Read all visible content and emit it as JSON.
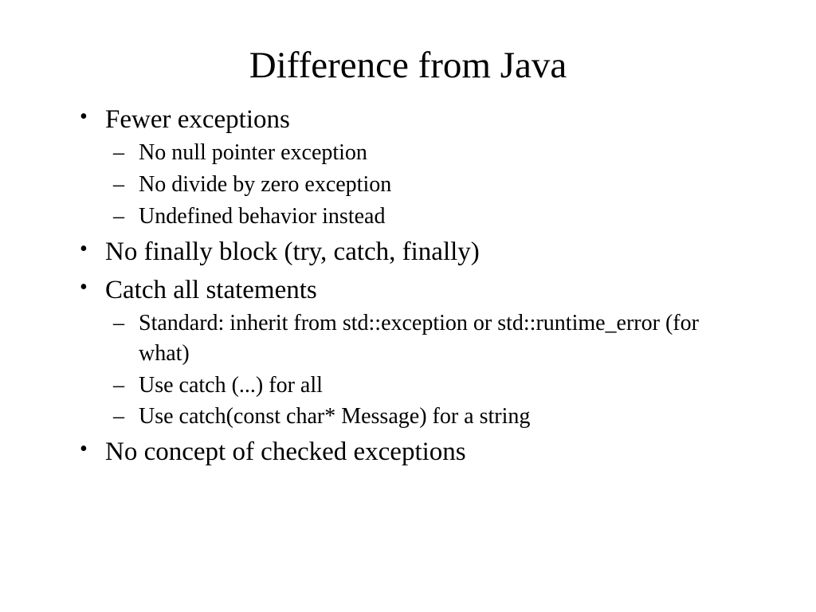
{
  "title": "Difference from Java",
  "bullets": {
    "b1": "Fewer exceptions",
    "b1_1": "No null pointer exception",
    "b1_2": "No divide by zero exception",
    "b1_3": "Undefined behavior instead",
    "b2": "No finally block (try, catch, finally)",
    "b3": "Catch all statements",
    "b3_1": "Standard: inherit from std::exception  or std::runtime_error (for what)",
    "b3_2": "Use catch (...) for all",
    "b3_3": "Use catch(const char* Message) for a string",
    "b4": "No concept of checked exceptions"
  }
}
